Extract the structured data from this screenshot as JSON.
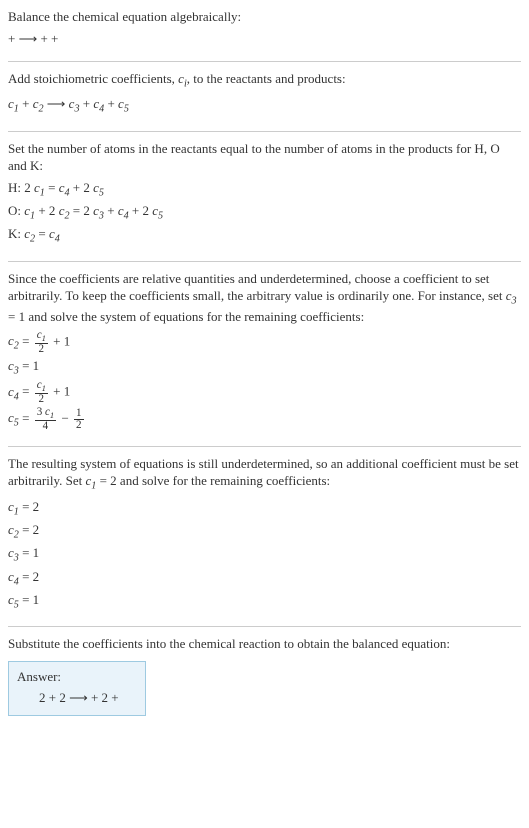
{
  "chart_data": {
    "type": "table",
    "title": "Balance chemical equation algebraically",
    "reactants_generic": "c1 + c2",
    "products_generic": "c3 + c4 + c5",
    "elements": [
      "H",
      "O",
      "K"
    ],
    "element_equations": {
      "H": "2 c1 = c4 + 2 c5",
      "O": "c1 + 2 c2 = 2 c3 + c4 + 2 c5",
      "K": "c2 = c4"
    },
    "arbitrary_first": {
      "c3": 1
    },
    "system_after_first": {
      "c2": "c1/2 + 1",
      "c3": "1",
      "c4": "c1/2 + 1",
      "c5": "3 c1 / 4 - 1/2"
    },
    "arbitrary_second": {
      "c1": 2
    },
    "final_coefficients": {
      "c1": 2,
      "c2": 2,
      "c3": 1,
      "c4": 2,
      "c5": 1
    },
    "balanced_equation": "2 + 2 ⟶ + 2 +"
  },
  "intro": {
    "line1": "Balance the chemical equation algebraically:",
    "eq": " +  ⟶  +  + "
  },
  "sec1": {
    "line1_a": "Add stoichiometric coefficients, ",
    "line1_b": ", to the reactants and products:",
    "eq_pre": " + ",
    "eq_mid": "  ⟶ ",
    "eq_post1": " + ",
    "eq_post2": " + "
  },
  "sec2": {
    "line1": "Set the number of atoms in the reactants equal to the number of atoms in the products for H, O and K:",
    "H_label": "H:  ",
    "H_lhs": "2 ",
    "H_eq": " = ",
    "H_rhs_mid": " + 2 ",
    "O_label": "O:  ",
    "O_mid1": " + 2 ",
    "O_eq": " = 2 ",
    "O_mid2": " + ",
    "O_mid3": " + 2 ",
    "K_label": "K:  ",
    "K_eq": " = "
  },
  "sec3": {
    "para": "Since the coefficients are relative quantities and underdetermined, choose a coefficient to set arbitrarily. To keep the coefficients small, the arbitrary value is ordinarily one. For instance, set ",
    "para_tail": " = 1 and solve the system of equations for the remaining coefficients:",
    "c2_eq_tail": " + 1",
    "c3_eq": " = 1",
    "c4_eq_tail": " + 1",
    "c5_mid": " − ",
    "num3c1": "3 ",
    "den4": "4",
    "num1": "1",
    "den2a": "2",
    "den2b": "2",
    "den2c": "2"
  },
  "sec4": {
    "para": "The resulting system of equations is still underdetermined, so an additional coefficient must be set arbitrarily. Set ",
    "para_tail": " = 2 and solve for the remaining coefficients:",
    "v1": " = 2",
    "v2": " = 2",
    "v3": " = 1",
    "v4": " = 2",
    "v5": " = 1"
  },
  "sec5": {
    "para": "Substitute the coefficients into the chemical reaction to obtain the balanced equation:"
  },
  "answer": {
    "label": "Answer:",
    "eq": "2  + 2  ⟶  + 2  + "
  },
  "sym": {
    "ci": "c",
    "i": "i",
    "c1": "c",
    "s1": "1",
    "c2": "c",
    "s2": "2",
    "c3": "c",
    "s3": "3",
    "c4": "c",
    "s4": "4",
    "c5": "c",
    "s5": "5",
    "eq": " = "
  }
}
